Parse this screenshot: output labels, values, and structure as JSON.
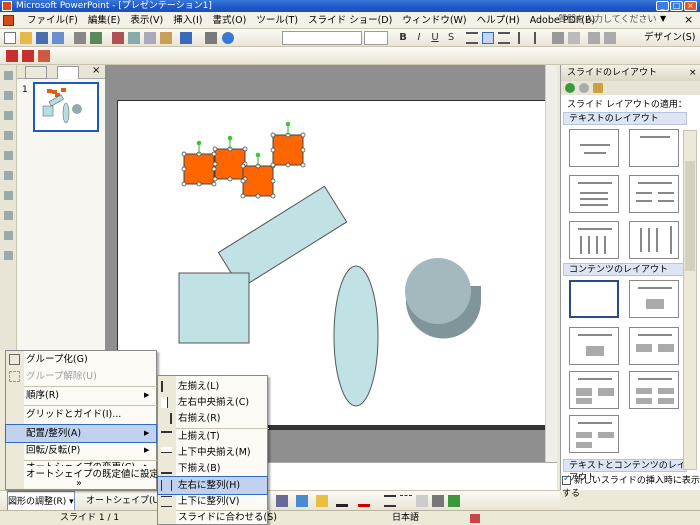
{
  "window": {
    "title": "Microsoft PowerPoint - [プレゼンテーション1]",
    "minimize": "_",
    "maximize": "□",
    "close": "×"
  },
  "menubar": {
    "items": [
      "ファイル(F)",
      "編集(E)",
      "表示(V)",
      "挿入(I)",
      "書式(O)",
      "ツール(T)",
      "スライド ショー(D)",
      "ウィンドウ(W)",
      "ヘルプ(H)",
      "Adobe PDF(B)"
    ],
    "help_placeholder": "質問を入力してください",
    "help_dropdown": "▼",
    "doc_close": "×"
  },
  "toolbar": {
    "design_label": "デザイン(S)",
    "bold": "B",
    "italic": "I",
    "underline": "U",
    "shadow": "S"
  },
  "thumbnails": {
    "slide_number": "1",
    "close": "×"
  },
  "task_pane": {
    "title": "スライドのレイアウト",
    "close": "×",
    "apply_label": "スライド レイアウトの適用：",
    "sections": [
      "テキストのレイアウト",
      "コンテンツのレイアウト",
      "テキストとコンテンツのレイアウト"
    ],
    "checkbox_label": "新しいスライドの挿入時に表示する"
  },
  "draw_toolbar": {
    "draw_menu": "図形の調整(R) ▾",
    "autoshape_menu": "オートシェイプ(U) ▾"
  },
  "statusbar": {
    "slide": "スライド 1 / 1",
    "language": "日本語"
  },
  "draw_menu": {
    "items": [
      {
        "label": "グループ化(G)",
        "disabled": false,
        "submenu": false
      },
      {
        "label": "グループ解除(U)",
        "disabled": true,
        "submenu": false
      },
      {
        "label": "順序(R)",
        "disabled": false,
        "submenu": true
      },
      {
        "label": "グリッドとガイド(I)...",
        "disabled": false,
        "submenu": false
      },
      {
        "label": "配置/整列(A)",
        "disabled": false,
        "submenu": true,
        "highlighted": true
      },
      {
        "label": "回転/反転(P)",
        "disabled": false,
        "submenu": true
      },
      {
        "label": "オートシェイプの変更(C)",
        "disabled": false,
        "submenu": true
      },
      {
        "label": "オートシェイプの既定値に設定(D)",
        "disabled": false,
        "submenu": false
      }
    ],
    "expand": "»"
  },
  "align_menu": {
    "items": [
      {
        "label": "左揃え(L)"
      },
      {
        "label": "左右中央揃え(C)"
      },
      {
        "label": "右揃え(R)"
      },
      {
        "label": "上揃え(T)"
      },
      {
        "label": "上下中央揃え(M)"
      },
      {
        "label": "下揃え(B)"
      },
      {
        "label": "左右に整列(H)",
        "highlighted": true
      },
      {
        "label": "上下に整列(V)"
      },
      {
        "label": "スライドに合わせる(S)"
      }
    ]
  }
}
